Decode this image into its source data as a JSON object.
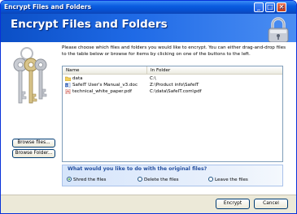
{
  "window": {
    "title": "Encrypt Files and Folders",
    "controls": {
      "minimize": "_",
      "maximize": "□",
      "close": "✕"
    }
  },
  "header": {
    "title": "Encrypt Files and Folders",
    "icon": "padlock-icon"
  },
  "decoration": {
    "icon": "keys-icon"
  },
  "instructions": "Please choose which files and folders you would like to encrypt. You can either drag-and-drop files to the table below or browse for items by clicking on one of the buttons to the left.",
  "file_list": {
    "columns": [
      "Name",
      "In Folder"
    ],
    "rows": [
      {
        "name": "data",
        "folder": "C:\\",
        "icon": "folder-icon"
      },
      {
        "name": "SafeIT User's Manual_v3.doc",
        "folder": "Z:\\Product info\\SafeIT",
        "icon": "word-doc-icon"
      },
      {
        "name": "technical_white_paper.pdf",
        "folder": "C:\\data\\SafeIT.com\\pdf",
        "icon": "pdf-icon"
      }
    ]
  },
  "buttons": {
    "browse_files": "Browse files...",
    "browse_folder": "Browse Folder...",
    "encrypt": "Encrypt",
    "cancel": "Cancel"
  },
  "original_files_options": {
    "question": "What would you like to do with the original files?",
    "options": [
      {
        "label": "Shred the files",
        "selected": true
      },
      {
        "label": "Delete the files",
        "selected": false
      },
      {
        "label": "Leave the files",
        "selected": false
      }
    ]
  },
  "colors": {
    "title_blue": "#0a5ce0",
    "accent_text": "#234e9e",
    "radio_selected": "#2f9e2a"
  }
}
